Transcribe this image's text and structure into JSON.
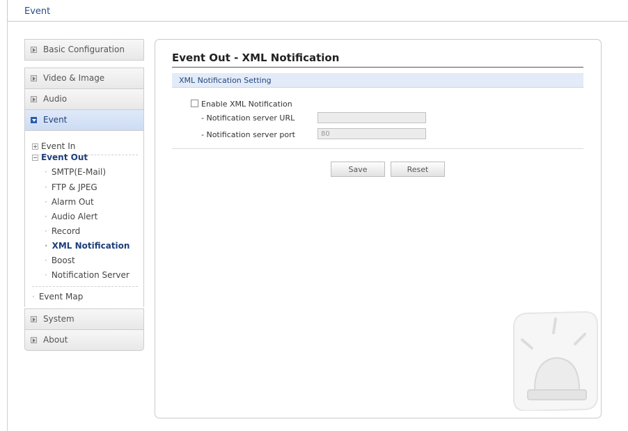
{
  "header": {
    "title": "Event"
  },
  "sidebar": {
    "basic_configuration": "Basic Configuration",
    "video_image": "Video & Image",
    "audio": "Audio",
    "event": "Event",
    "event_in": "Event In",
    "event_out": "Event Out",
    "event_out_items": [
      "SMTP(E-Mail)",
      "FTP & JPEG",
      "Alarm Out",
      "Audio Alert",
      "Record",
      "XML Notification",
      "Boost",
      "Notification Server"
    ],
    "event_map": "Event Map",
    "system": "System",
    "about": "About"
  },
  "main": {
    "title": "Event Out - XML Notification",
    "section_title": "XML Notification Setting",
    "enable_label": "Enable XML Notification",
    "enable_checked": false,
    "url_label": "- Notification server URL",
    "url_value": "",
    "port_label": "- Notification server port",
    "port_value": "80",
    "save_button": "Save",
    "reset_button": "Reset"
  },
  "icons": {
    "sidebar_collapsed": "collapsed-arrow-icon",
    "sidebar_expanded": "expanded-arrow-icon",
    "tree_plus": "tree-plus-icon",
    "tree_minus": "tree-minus-icon",
    "decoration": "alarm-light-icon"
  },
  "colors": {
    "accent": "#1e3f7a",
    "section_bar": "#e3ebf8",
    "active_nav": "#d6e3f6"
  }
}
